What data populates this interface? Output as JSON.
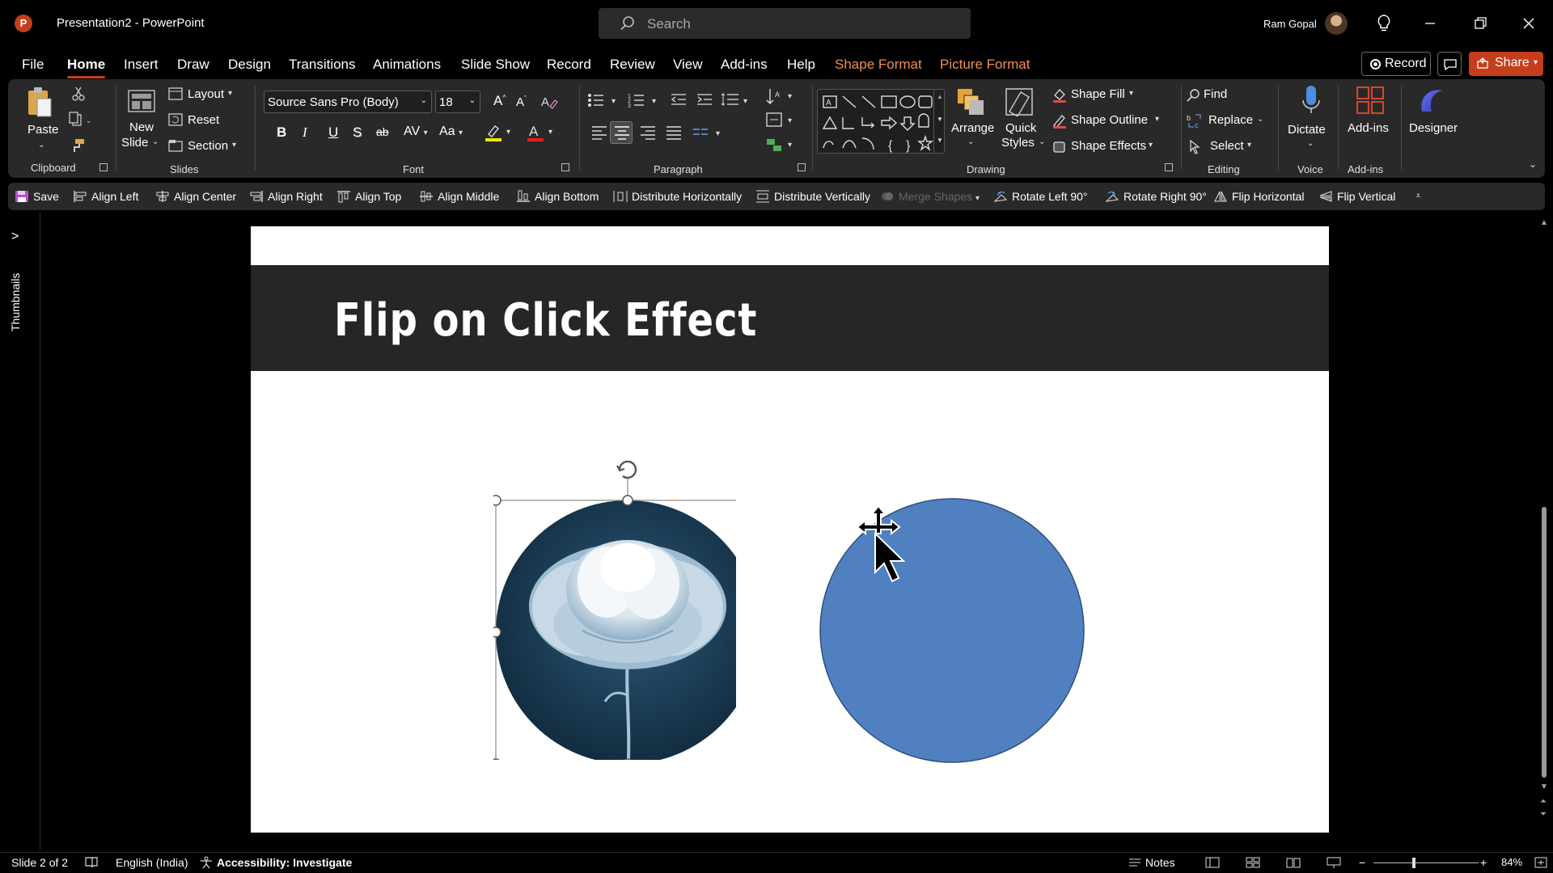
{
  "window": {
    "title": "Presentation2  -  PowerPoint",
    "user_name": "Ram Gopal",
    "search_placeholder": "Search"
  },
  "menu": {
    "tabs": [
      "File",
      "Home",
      "Insert",
      "Draw",
      "Design",
      "Transitions",
      "Animations",
      "Slide Show",
      "Record",
      "Review",
      "View",
      "Add-ins",
      "Help"
    ],
    "context_tabs": [
      "Shape Format",
      "Picture Format"
    ],
    "active_tab": "Home",
    "record_label": "Record",
    "share_label": "Share"
  },
  "ribbon": {
    "clipboard": {
      "paste": "Paste",
      "group": "Clipboard"
    },
    "slides": {
      "new_slide_1": "New",
      "new_slide_2": "Slide",
      "layout": "Layout",
      "reset": "Reset",
      "section": "Section",
      "group": "Slides"
    },
    "font": {
      "name": "Source Sans Pro (Body)",
      "size": "18",
      "bold": "B",
      "italic": "I",
      "underline": "U",
      "shadow": "S",
      "strike": "ab",
      "spacing": "AV",
      "case": "Aa",
      "group": "Font"
    },
    "paragraph": {
      "group": "Paragraph"
    },
    "drawing": {
      "arrange": "Arrange",
      "quick_styles_1": "Quick",
      "quick_styles_2": "Styles",
      "shape_fill": "Shape Fill",
      "shape_outline": "Shape Outline",
      "shape_effects": "Shape Effects",
      "group": "Drawing"
    },
    "editing": {
      "find": "Find",
      "replace": "Replace",
      "select": "Select",
      "group": "Editing"
    },
    "voice": {
      "dictate": "Dictate",
      "group": "Voice"
    },
    "addins": {
      "addins": "Add-ins",
      "group": "Add-ins"
    },
    "designer": {
      "label": "Designer"
    }
  },
  "quick_access": {
    "items": [
      "Save",
      "Align Left",
      "Align Center",
      "Align Right",
      "Align Top",
      "Align Middle",
      "Align Bottom",
      "Distribute Horizontally",
      "Distribute Vertically",
      "Merge Shapes",
      "Rotate Left 90°",
      "Rotate Right 90°",
      "Flip Horizontal",
      "Flip Vertical"
    ],
    "disabled": [
      "Merge Shapes"
    ]
  },
  "sidebar": {
    "thumbnails_label": "Thumbnails"
  },
  "slide": {
    "title": "Flip on Click Effect",
    "picture_name": "flower-picture",
    "circle_color": "#5080c0",
    "band_color": "#262626"
  },
  "status": {
    "slide_indicator": "Slide 2 of 2",
    "language": "English (India)",
    "accessibility": "Accessibility: Investigate",
    "notes": "Notes",
    "zoom": "84%"
  },
  "colors": {
    "accent": "#c43e1c",
    "context_tab": "#ef8e54",
    "ribbon_bg": "#292929"
  }
}
